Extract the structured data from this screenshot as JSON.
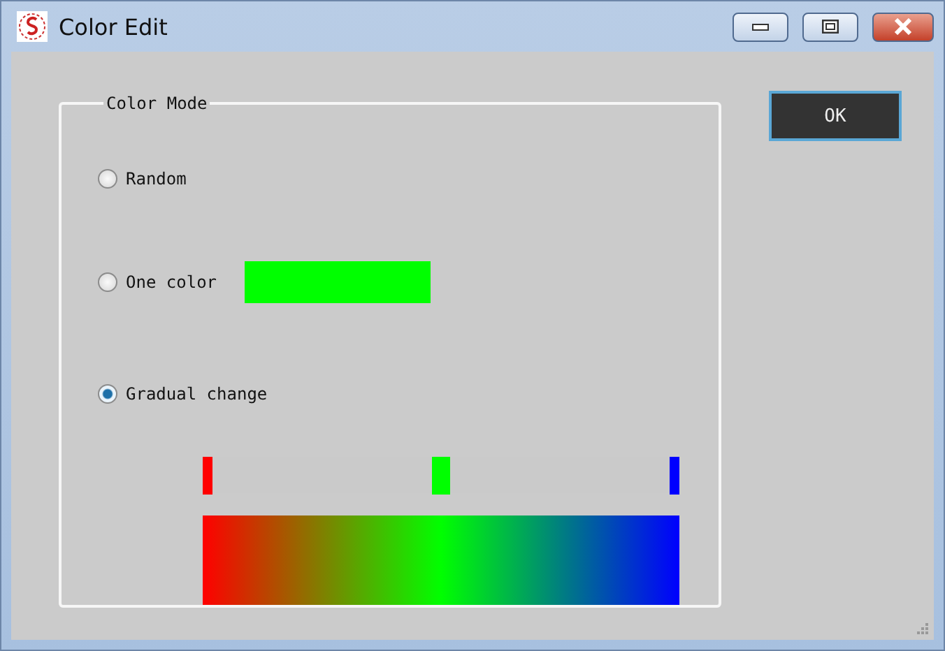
{
  "window": {
    "title": "Color Edit"
  },
  "ok_button": "OK",
  "color_mode": {
    "title": "Color Mode",
    "options": [
      {
        "kind": "plain",
        "label": "Random",
        "selected": false
      },
      {
        "kind": "swatch",
        "label": "One color",
        "selected": false,
        "color": "#00ff00"
      },
      {
        "kind": "plain",
        "label": "Gradual change",
        "selected": true
      }
    ],
    "gradient_stops": [
      {
        "color": "#ff0000",
        "level": 0
      },
      {
        "color": "#00ff00",
        "level": 0.5
      },
      {
        "color": "#0000ff",
        "level": 1
      }
    ]
  }
}
